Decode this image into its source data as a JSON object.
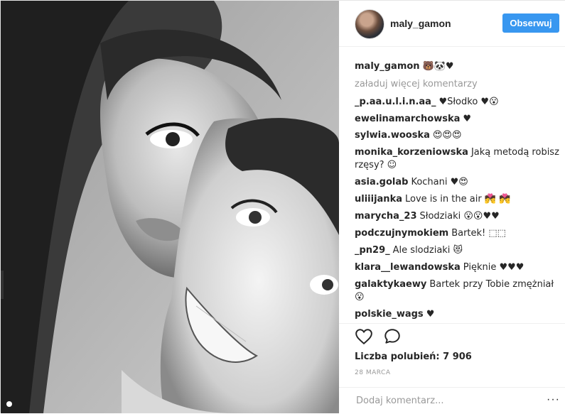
{
  "post": {
    "username": "maly_gamon",
    "follow_label": "Obserwuj",
    "caption_user": "maly_gamon",
    "caption_text": "🐻🐼♥",
    "load_more": "załaduj więcej komentarzy",
    "comments": [
      {
        "user": "_p.aa.u.l.i.n.aa_",
        "text": "♥Słodko ♥😮"
      },
      {
        "user": "ewelinamarchowska",
        "text": "♥"
      },
      {
        "user": "sylwia.wooska",
        "text": "😍😍😍"
      },
      {
        "user": "monika_korzeniowska",
        "text": "Jaką metodą robisz rzęsy? ☺"
      },
      {
        "user": "asia.golab",
        "text": "Kochani ♥😍"
      },
      {
        "user": "uliiijanka",
        "text": "Love is in the air 💏 💏"
      },
      {
        "user": "marycha_23",
        "text": "Słodziaki 😮😮♥♥"
      },
      {
        "user": "podczujnymokiem",
        "text": "Bartek! ⬚⬚"
      },
      {
        "user": "_pn29_",
        "text": "Ale slodziaki 😻"
      },
      {
        "user": "klara__lewandowska",
        "text": "Pięknie ♥♥♥"
      },
      {
        "user": "galaktykaewy",
        "text": "Bartek przy Tobie zmężniał 😮"
      },
      {
        "user": "polskie_wags",
        "text": "♥"
      }
    ],
    "likes_text": "Liczba polubień: 7 906",
    "date": "28 MARCA",
    "comment_placeholder": "Dodaj komentarz...",
    "more_options": "···",
    "icons": {
      "like": "heart-outline-icon",
      "comment": "speech-bubble-icon"
    }
  }
}
